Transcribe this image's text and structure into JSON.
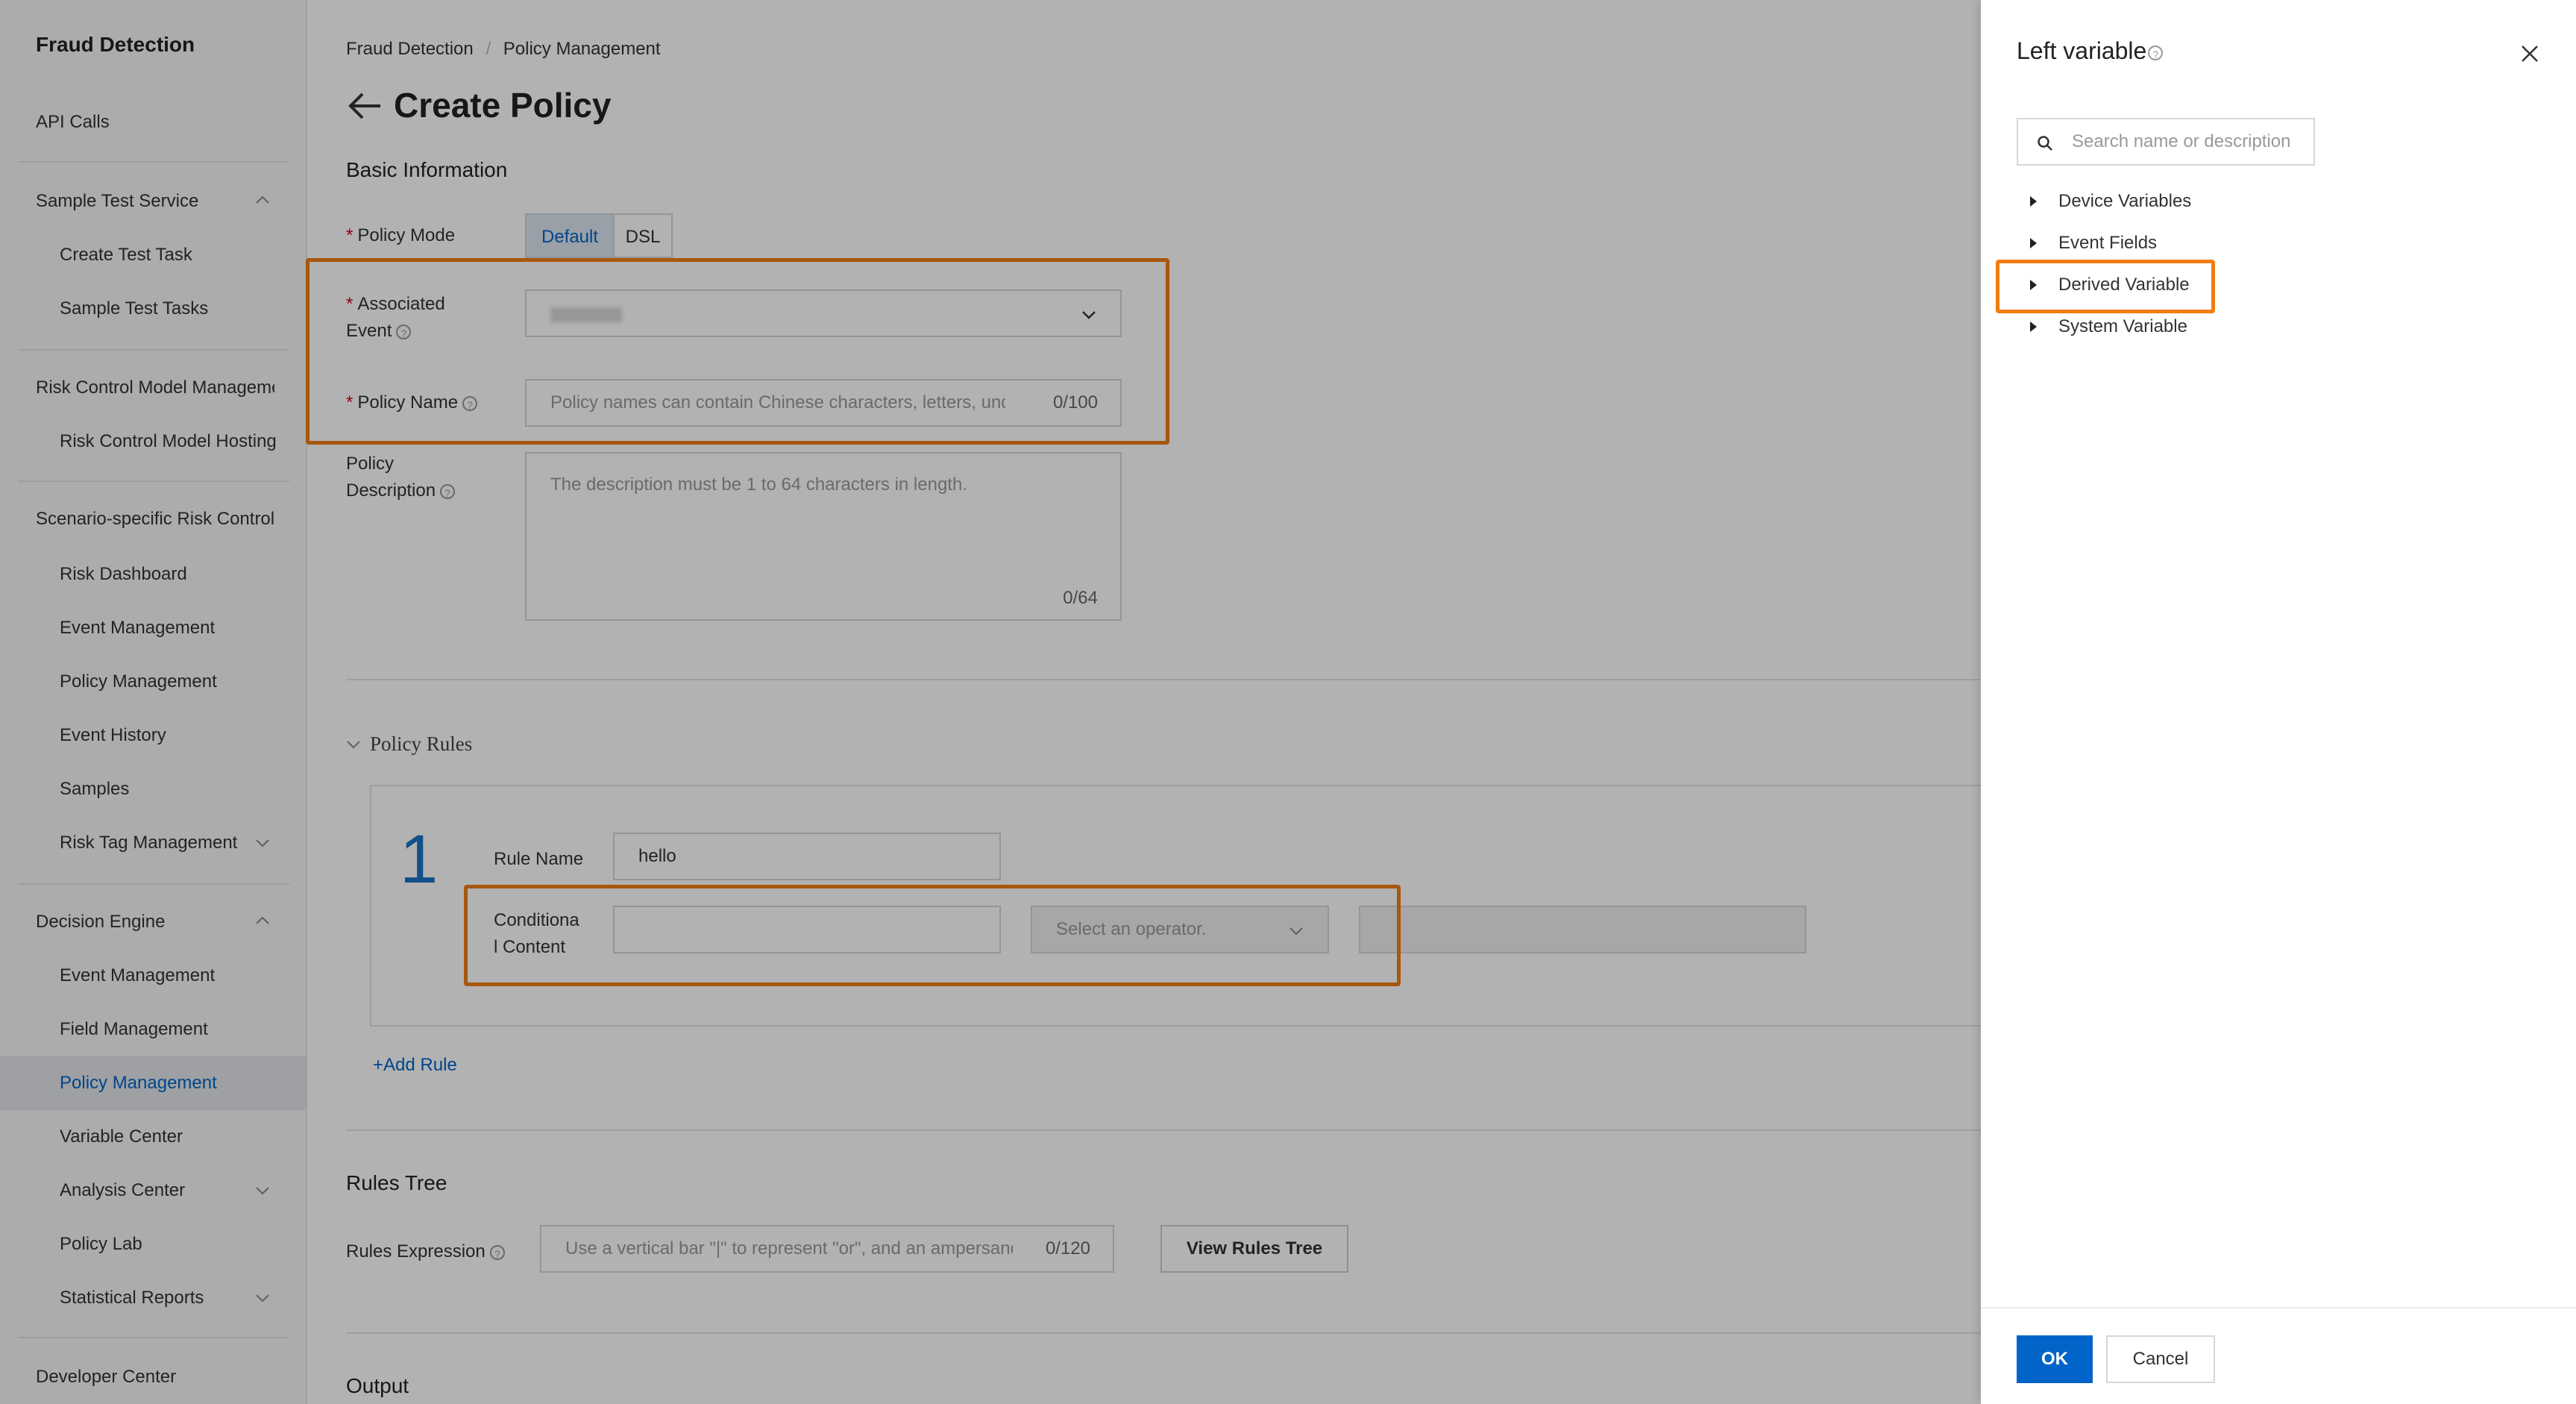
{
  "sidebar": {
    "title": "Fraud Detection",
    "items": [
      {
        "label": "API Calls"
      },
      {
        "label": "Sample Test Service"
      },
      {
        "label": "Create Test Task"
      },
      {
        "label": "Sample Test Tasks"
      },
      {
        "label": "Risk Control Model Management"
      },
      {
        "label": "Risk Control Model Hosting"
      },
      {
        "label": "Scenario-specific Risk Control"
      },
      {
        "label": "Risk Dashboard"
      },
      {
        "label": "Event Management"
      },
      {
        "label": "Policy Management"
      },
      {
        "label": "Event History"
      },
      {
        "label": "Samples"
      },
      {
        "label": "Risk Tag Management"
      },
      {
        "label": "Decision Engine"
      },
      {
        "label": "Event Management"
      },
      {
        "label": "Field Management"
      },
      {
        "label": "Policy Management"
      },
      {
        "label": "Variable Center"
      },
      {
        "label": "Analysis Center"
      },
      {
        "label": "Policy Lab"
      },
      {
        "label": "Statistical Reports"
      },
      {
        "label": "Developer Center"
      }
    ]
  },
  "breadcrumb": {
    "root": "Fraud Detection",
    "separator": "/",
    "current": "Policy Management"
  },
  "page": {
    "title": "Create Policy"
  },
  "basic": {
    "section_title": "Basic Information",
    "policy_mode": {
      "label": "Policy Mode",
      "options": [
        "Default",
        "DSL"
      ]
    },
    "associated_event": {
      "label_line1": "Associated",
      "label_line2": "Event"
    },
    "policy_name": {
      "label": "Policy Name",
      "placeholder": "Policy names can contain Chinese characters, letters, underscores, and digits.",
      "count": "0/100"
    },
    "policy_description": {
      "label_line1": "Policy",
      "label_line2": "Description",
      "placeholder": "The description must be 1 to 64 characters in length.",
      "count": "0/64"
    }
  },
  "rules": {
    "section_title": "Policy Rules",
    "rule_index": "1",
    "rule_name_label": "Rule Name",
    "rule_name_value": "hello",
    "condition_label_line1": "Conditiona",
    "condition_label_line2": "l Content",
    "operator_placeholder": "Select an operator.",
    "add_rule": "+Add Rule"
  },
  "rules_tree": {
    "section_title": "Rules Tree",
    "expression_label": "Rules Expression",
    "expression_placeholder": "Use a vertical bar \"|\" to represent \"or\", and an ampersand \"&\" to represent \"and\".",
    "count": "0/120",
    "view_button": "View Rules Tree"
  },
  "output": {
    "section_title": "Output"
  },
  "drawer": {
    "title": "Left variable",
    "search_placeholder": "Search name or description",
    "tree": [
      {
        "label": "Device Variables"
      },
      {
        "label": "Event Fields"
      },
      {
        "label": "Derived Variable"
      },
      {
        "label": "System Variable"
      }
    ],
    "ok": "OK",
    "cancel": "Cancel"
  },
  "colors": {
    "primary": "#0064c8",
    "highlight": "#f07d14",
    "required": "#d9001b"
  }
}
